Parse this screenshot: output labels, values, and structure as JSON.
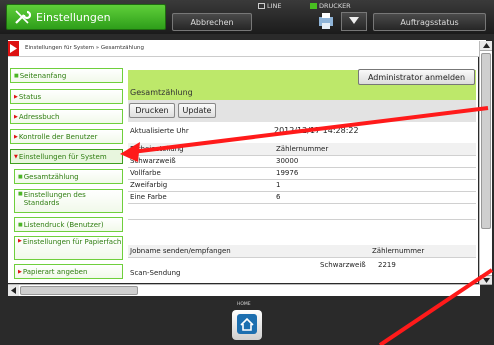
{
  "app": {
    "title": "Einstellungen",
    "cancel_label": "Abbrechen",
    "job_status_label": "Auftragsstatus",
    "line_label": "LINE",
    "printer_label": "DRUCKER",
    "home_label": "HOME"
  },
  "breadcrumb": "Einstellungen für System » Gesamtzählung",
  "sidebar": {
    "items": [
      {
        "label": "Seitenanfang",
        "style": "green"
      },
      {
        "label": "Status",
        "style": "red"
      },
      {
        "label": "Adressbuch",
        "style": "red"
      },
      {
        "label": "Kontrolle der Benutzer",
        "style": "red"
      },
      {
        "label": "Einstellungen für System",
        "style": "red",
        "active": true
      },
      {
        "label": "Gesamtzählung",
        "style": "green",
        "sub": true
      },
      {
        "label": "Einstellungen des Standards",
        "style": "green",
        "sub": true
      },
      {
        "label": "Listendruck (Benutzer)",
        "style": "green",
        "sub": true
      },
      {
        "label": "Einstellungen für Papierfach",
        "style": "red",
        "sub": true
      },
      {
        "label": "Papierart angeben",
        "style": "red",
        "sub": true
      }
    ]
  },
  "content": {
    "admin_button": "Administrator anmelden",
    "section_title": "Gesamtzählung",
    "print_button": "Drucken",
    "update_button": "Update",
    "updated_label": "Aktualisierte Uhr",
    "updated_value": "2012/12/17 14:28:22",
    "table1": {
      "col1": "Farbeinstellung",
      "col2": "Zählernummer",
      "rows": [
        {
          "label": "Schwarzweiß",
          "value": "30000"
        },
        {
          "label": "Vollfarbe",
          "value": "19976"
        },
        {
          "label": "Zweifarbig",
          "value": "1"
        },
        {
          "label": "Eine Farbe",
          "value": "6"
        }
      ]
    },
    "table2": {
      "col1": "Jobname senden/empfangen",
      "col2": "Zählernummer",
      "row": {
        "label": "Scan-Sendung",
        "mode": "Schwarzweiß",
        "value": "2219"
      }
    }
  },
  "colors": {
    "accent_green": "#bde86a",
    "brand_green": "#2e9e1a",
    "annotation_red": "#ff1a1a"
  }
}
